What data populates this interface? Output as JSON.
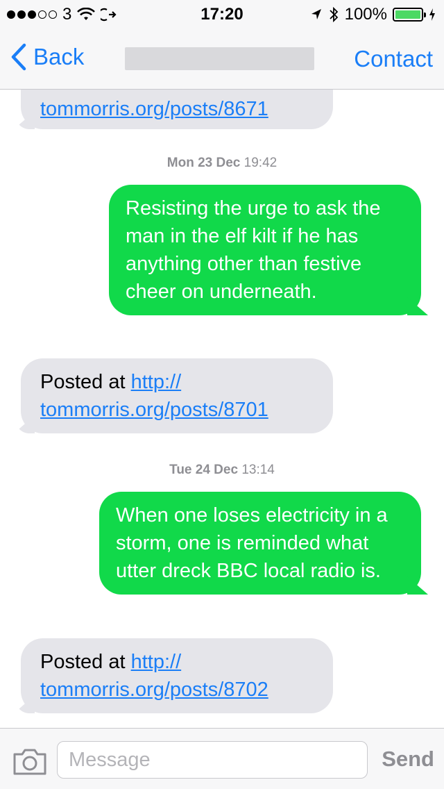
{
  "status_bar": {
    "carrier": "3",
    "time": "17:20",
    "battery": "100%",
    "battery_level": 1.0,
    "signal_bars_filled": 3,
    "signal_bars_total": 5
  },
  "nav": {
    "back_label": "Back",
    "contact_label": "Contact"
  },
  "messages": {
    "m1": {
      "link": "tommorris.org/posts/8671"
    },
    "ts1": {
      "day": "Mon 23 Dec",
      "time": "19:42"
    },
    "m2": {
      "text": "Resisting the urge to ask the man in the elf kilt if he has anything other than festive cheer on underneath."
    },
    "m3": {
      "prefix": "Posted at ",
      "link_line1": "http://",
      "link_line2": "tommorris.org/posts/8701"
    },
    "ts2": {
      "day": "Tue 24 Dec",
      "time": "13:14"
    },
    "m4": {
      "text": "When one loses electricity in a storm, one is reminded what utter dreck BBC local radio is."
    },
    "m5": {
      "prefix": "Posted at ",
      "link_line1": "http://",
      "link_line2": "tommorris.org/posts/8702"
    }
  },
  "input": {
    "placeholder": "Message",
    "send_label": "Send"
  },
  "colors": {
    "accent": "#1a7ef7",
    "outgoing_bubble": "#11d94a",
    "incoming_bubble": "#e5e5ea"
  },
  "icons": [
    "signal-dots-icon",
    "wifi-icon",
    "activity-icon",
    "location-icon",
    "bluetooth-icon",
    "battery-icon",
    "chevron-left-icon",
    "camera-icon"
  ]
}
